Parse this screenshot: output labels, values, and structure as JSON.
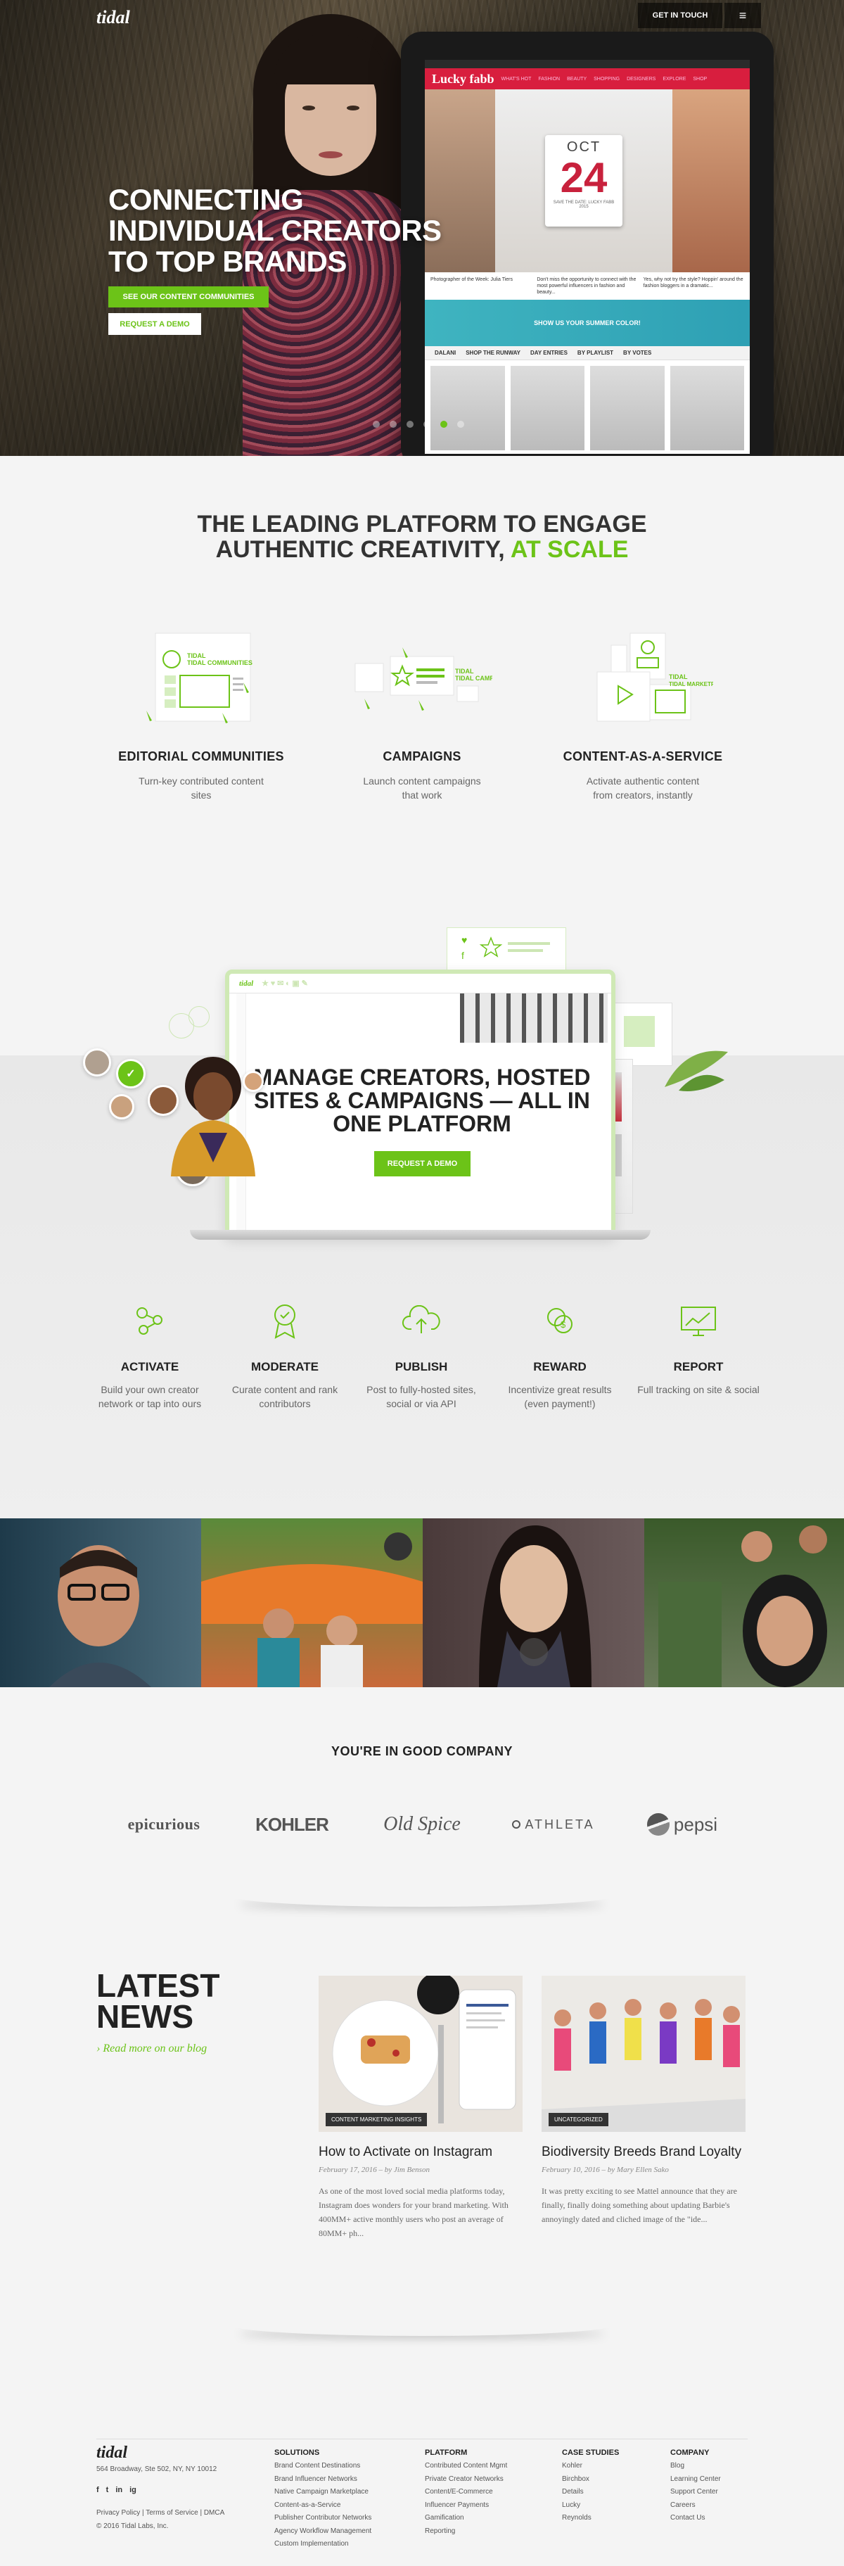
{
  "nav": {
    "logo": "tidal",
    "cta": "GET IN TOUCH",
    "menu_icon": "≡"
  },
  "hero": {
    "title": "CONNECTING INDIVIDUAL CREATORS TO TOP BRANDS",
    "btn_content": "SEE OUR CONTENT COMMUNITIES",
    "btn_demo": "REQUEST A DEMO",
    "slides": 6,
    "active_slide": 5,
    "tablet": {
      "site_logo": "Lucky fabb",
      "nav_items": [
        "WHAT'S HOT",
        "FASHION",
        "BEAUTY",
        "SHOPPING",
        "DESIGNERS",
        "EXPLORE",
        "SHOP"
      ],
      "cal_month": "OCT",
      "cal_day": "24",
      "cal_sub": "SAVE THE DATE: LUCKY FABB 2015",
      "row_texts": [
        "Photographer of the Week: Julia Tiers",
        "Don't miss the opportunity to connect with the most powerful influencers in fashion and beauty...",
        "Yes, why not try the style? Hoppin' around the fashion bloggers in a dramatic..."
      ],
      "banner": "SHOW US YOUR SUMMER COLOR!",
      "bar": [
        "DALANI",
        "SHOP THE RUNWAY",
        "DAY ENTRIES",
        "BY PLAYLIST",
        "BY VOTES"
      ]
    }
  },
  "platform": {
    "title_line1": "THE LEADING PLATFORM TO ENGAGE",
    "title_line2": "AUTHENTIC CREATIVITY,",
    "title_accent": "AT SCALE",
    "features": [
      {
        "title": "EDITORIAL COMMUNITIES",
        "desc": "Turn-key contributed content sites",
        "ill_label": "TIDAL COMMUNITIES"
      },
      {
        "title": "CAMPAIGNS",
        "desc": "Launch content campaigns that work",
        "ill_label": "TIDAL CAMPAIGNS"
      },
      {
        "title": "CONTENT-AS-A-SERVICE",
        "desc": "Activate authentic content from creators, instantly",
        "ill_label": "TIDAL MARKETPLACE"
      }
    ]
  },
  "manage": {
    "title": "MANAGE CREATORS, HOSTED SITES & CAMPAIGNS — ALL IN ONE PLATFORM",
    "cta": "REQUEST A DEMO",
    "app_logo": "tidal",
    "steps": [
      {
        "title": "ACTIVATE",
        "desc": "Build your own creator network or tap into ours",
        "icon": "network-icon"
      },
      {
        "title": "MODERATE",
        "desc": "Curate content and rank contributors",
        "icon": "badge-icon"
      },
      {
        "title": "PUBLISH",
        "desc": "Post to fully-hosted sites, social or via API",
        "icon": "cloud-upload-icon"
      },
      {
        "title": "REWARD",
        "desc": "Incentivize great results (even payment!)",
        "icon": "coins-icon"
      },
      {
        "title": "REPORT",
        "desc": "Full tracking on site & social",
        "icon": "chart-icon"
      }
    ]
  },
  "company": {
    "title": "YOU'RE IN GOOD COMPANY",
    "logos": [
      "epicurious",
      "KOHLER",
      "Old Spice",
      "ATHLETA",
      "pepsi"
    ]
  },
  "news": {
    "heading": "LATEST NEWS",
    "link": "› Read more on our blog",
    "posts": [
      {
        "tag": "CONTENT MARKETING INSIGHTS",
        "title": "How to Activate on Instagram",
        "date": "February 17, 2016",
        "author": "by Jim Benson",
        "excerpt": "As one of the most loved social media platforms today, Instagram does wonders for your brand marketing.  With 400MM+ active monthly users who post an average of 80MM+ ph..."
      },
      {
        "tag": "UNCATEGORIZED",
        "title": "Biodiversity Breeds Brand Loyalty",
        "date": "February 10, 2016",
        "author": "by Mary Ellen Sako",
        "excerpt": "It was pretty exciting to see Mattel announce that they are finally, finally doing something about updating Barbie's annoyingly dated and cliched image of the \"ide..."
      }
    ]
  },
  "footer": {
    "logo": "tidal",
    "address": "564 Broadway, Ste 502, NY, NY 10012",
    "social": [
      "f",
      "t",
      "in",
      "ig"
    ],
    "legal_links": "Privacy Policy | Terms of Service | DMCA",
    "copyright": "© 2016 Tidal Labs, Inc.",
    "cols": [
      {
        "title": "SOLUTIONS",
        "items": [
          "Brand Content Destinations",
          "Brand Influencer Networks",
          "Native Campaign Marketplace",
          "Content-as-a-Service",
          "Publisher Contributor Networks",
          "Agency Workflow Management",
          "Custom Implementation"
        ]
      },
      {
        "title": "PLATFORM",
        "items": [
          "Contributed Content Mgmt",
          "Private Creator Networks",
          "Content/E-Commerce",
          "Influencer Payments",
          "Gamification",
          "Reporting"
        ]
      },
      {
        "title": "CASE STUDIES",
        "items": [
          "Kohler",
          "Birchbox",
          "Details",
          "Lucky",
          "Reynolds"
        ]
      },
      {
        "title": "COMPANY",
        "items": [
          "Blog",
          "Learning Center",
          "Support Center",
          "Careers",
          "Contact Us"
        ]
      }
    ]
  },
  "colors": {
    "accent": "#6cc318",
    "text": "#222222",
    "bg": "#f4f4f4"
  }
}
